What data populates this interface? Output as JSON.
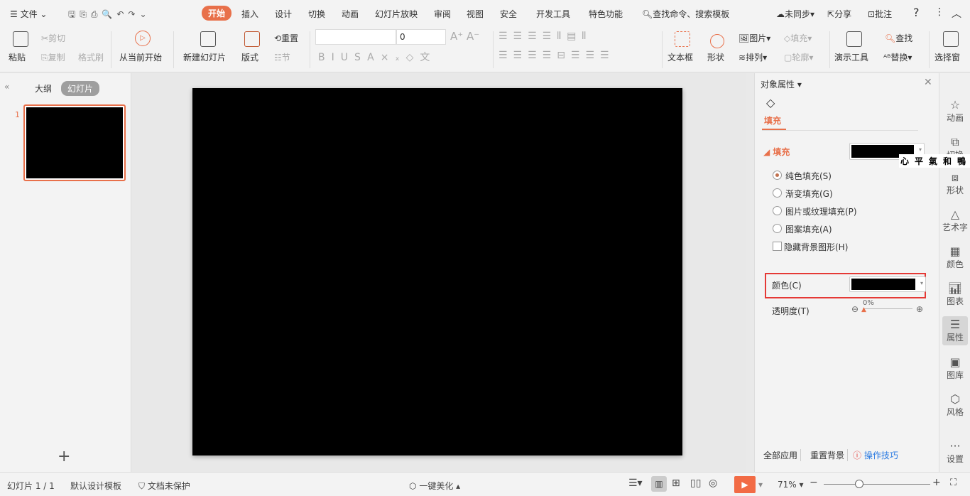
{
  "menu": {
    "file": "文件",
    "tabs": [
      "开始",
      "插入",
      "设计",
      "切换",
      "动画",
      "幻灯片放映",
      "审阅",
      "视图",
      "安全",
      "开发工具",
      "特色功能"
    ],
    "active_tab": "开始",
    "search": "查找命令、搜索模板",
    "sync": "未同步",
    "share": "分享",
    "comment": "批注",
    "help": "?"
  },
  "ribbon": {
    "paste": "粘贴",
    "cut": "剪切",
    "copy": "复制",
    "format_painter": "格式刷",
    "play_from_current": "从当前开始",
    "new_slide": "新建幻灯片",
    "layout": "版式",
    "reset": "重置",
    "section": "节",
    "font_name": "",
    "font_size": "0",
    "text_box": "文本框",
    "shape": "形状",
    "picture": "图片",
    "fill": "填充",
    "arrange": "排列",
    "outline": "轮廓",
    "presentation_tools": "演示工具",
    "find": "查找",
    "replace": "替换",
    "selection_pane": "选择窗"
  },
  "left_panel": {
    "tab_outline": "大纲",
    "tab_slides": "幻灯片",
    "slide_number": "1",
    "add": "+"
  },
  "property_panel": {
    "title": "对象属性",
    "tab_fill": "填充",
    "section_fill": "填充",
    "options": [
      "纯色填充(S)",
      "渐变填充(G)",
      "图片或纹理填充(P)",
      "图案填充(A)"
    ],
    "selected_option": "纯色填充(S)",
    "hide_bg": "隐藏背景图形(H)",
    "color_label": "颜色(C)",
    "color_value": "#000000",
    "transparency_label": "透明度(T)",
    "transparency_value": "0%",
    "apply_all": "全部应用",
    "reset_bg": "重置背景",
    "tips": "操作技巧",
    "watermark": "心平氣和鴨"
  },
  "side_bar": [
    "动画",
    "切换",
    "形状",
    "艺术字",
    "颜色",
    "图表",
    "属性",
    "图库",
    "风格",
    "设置"
  ],
  "status": {
    "slide_count": "幻灯片 1 / 1",
    "template": "默认设计模板",
    "protection": "文档未保护",
    "beautify": "一键美化",
    "zoom": "71%"
  },
  "colors": {
    "accent": "#e8704a",
    "highlight_box": "#e53935"
  }
}
